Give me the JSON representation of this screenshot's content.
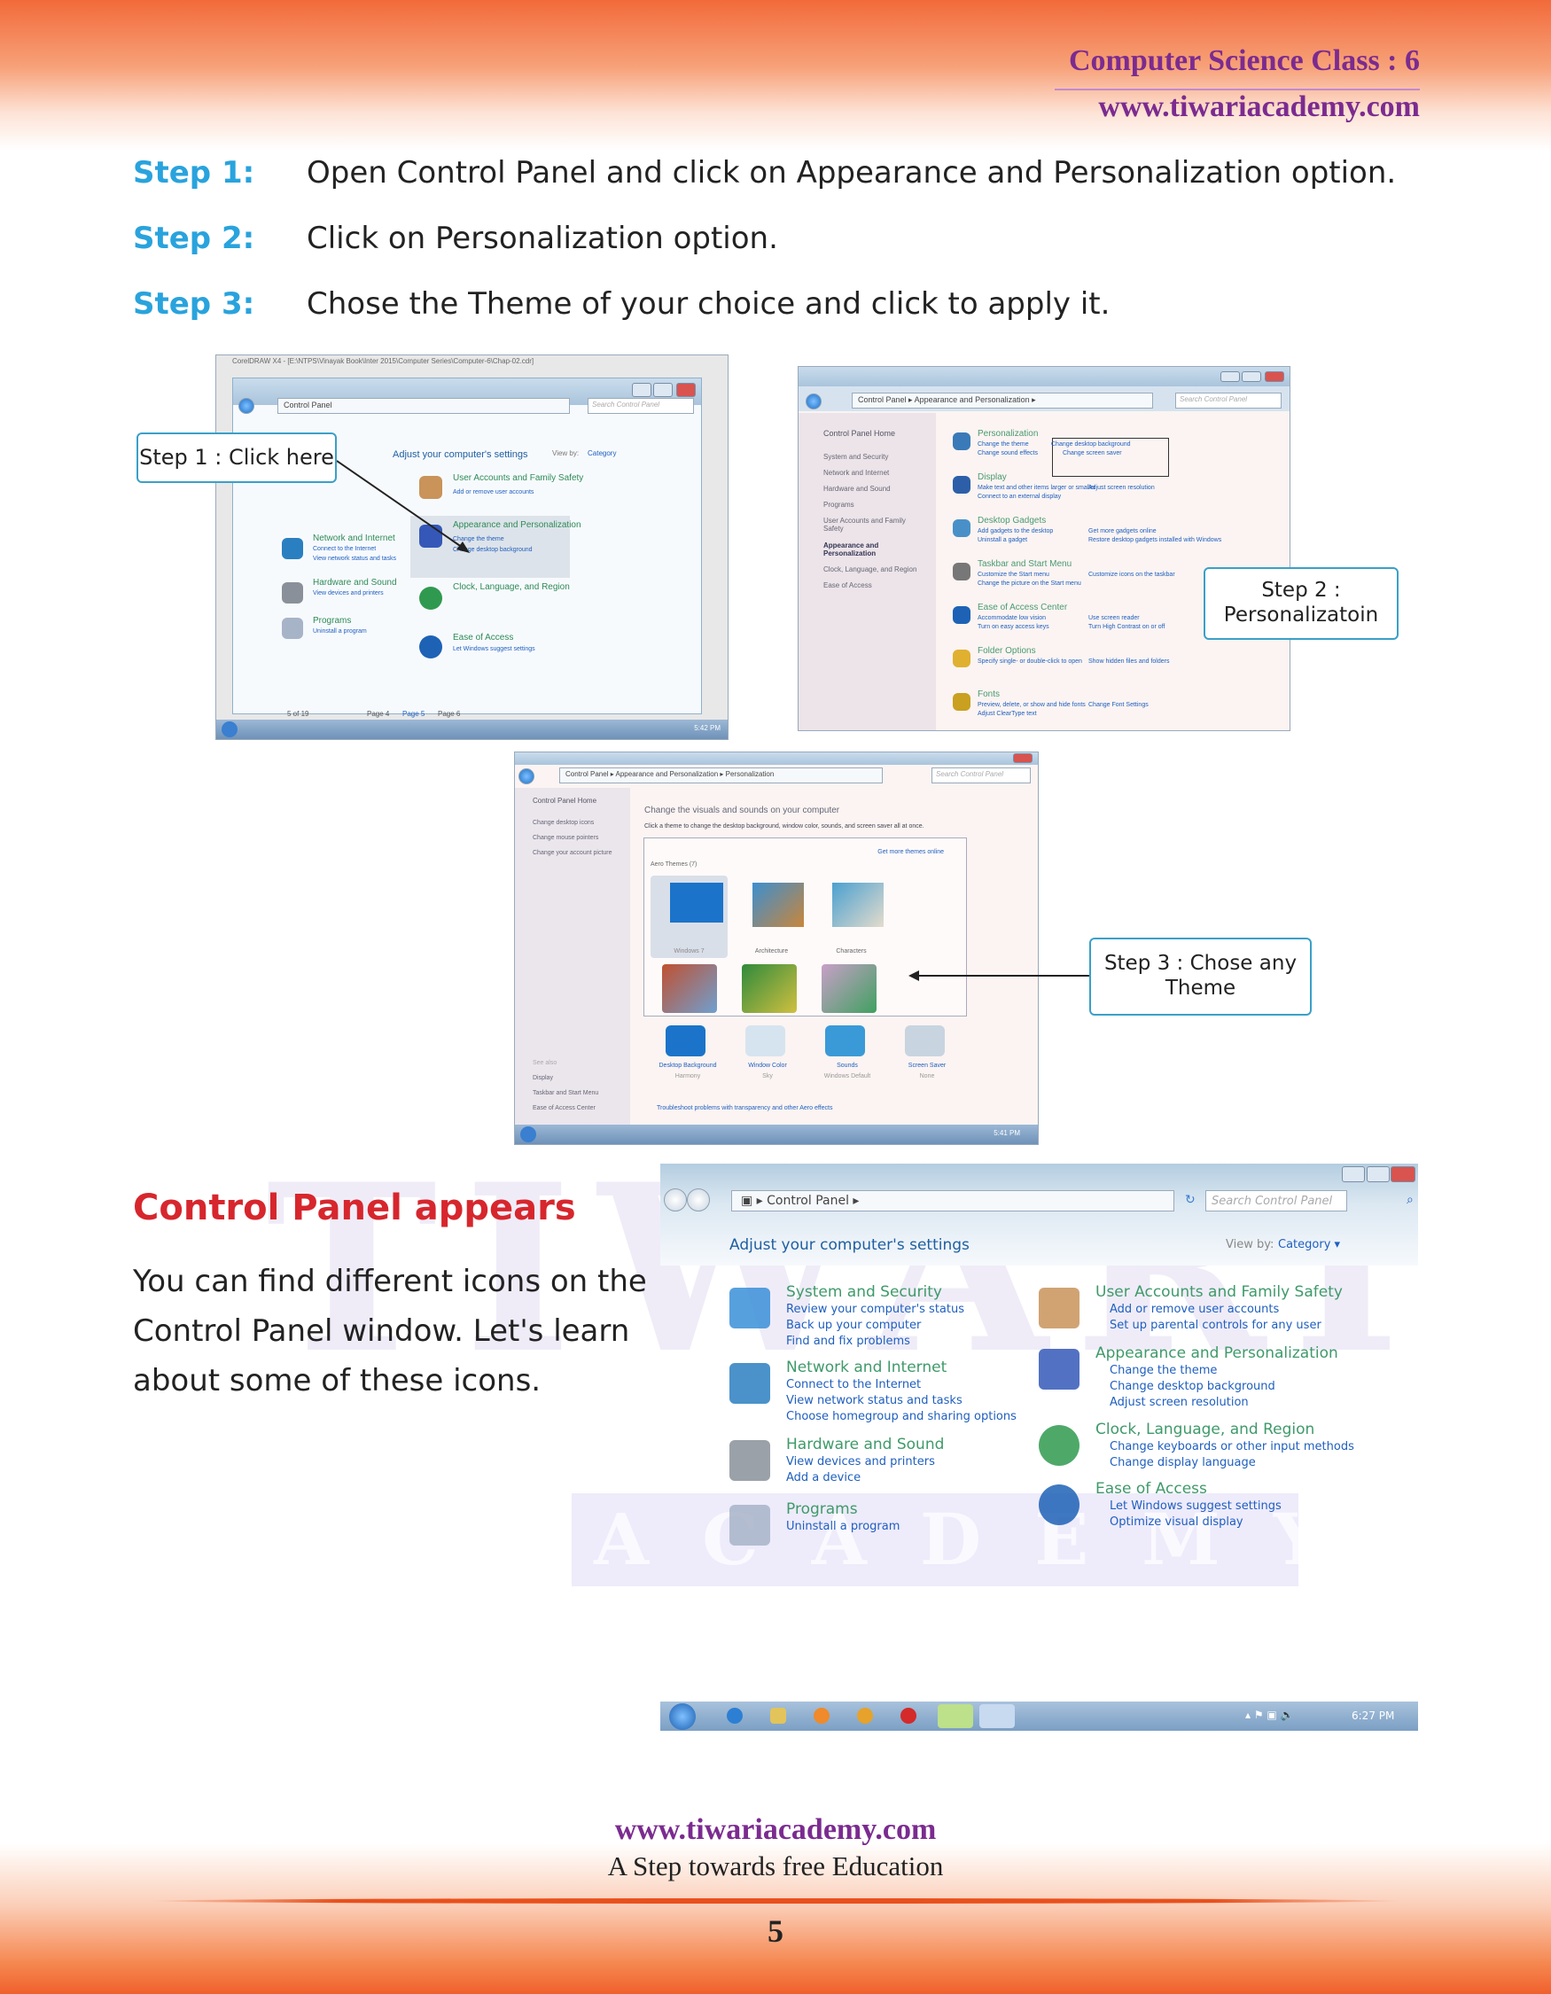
{
  "header": {
    "class_label": "Computer Science Class : 6",
    "website": "www.tiwariacademy.com"
  },
  "steps": [
    {
      "label": "Step 1:",
      "text": "Open Control Panel and click on Appearance and Personalization option."
    },
    {
      "label": "Step 2:",
      "text": "Click on Personalization option."
    },
    {
      "label": "Step 3:",
      "text": "Chose the Theme of your choice and click to apply it."
    }
  ],
  "callouts": {
    "step1": "Step 1 : Click here",
    "step2": "Step 2 : Personalizatoin",
    "step3": "Step 3 : Chose any Theme"
  },
  "shot1": {
    "app_title": "CorelDRAW X4 - [E:\\NTPS\\Vinayak Book\\Inter 2015\\Computer Series\\Computer-6\\Chap-02.cdr]",
    "breadcrumb": "Control Panel",
    "search_placeholder": "Search Control Panel",
    "heading": "Adjust your computer's settings",
    "view_by": "View by:",
    "view_value": "Category",
    "page_nav": "5 of 19",
    "page_tabs": [
      "Page 4",
      "Page 5",
      "Page 6"
    ],
    "time": "5:42 PM"
  },
  "shot2": {
    "breadcrumb": [
      "Control Panel",
      "Appearance and Personalization"
    ],
    "search_placeholder": "Search Control Panel",
    "sidebar": [
      "Control Panel Home",
      "System and Security",
      "Network and Internet",
      "Hardware and Sound",
      "Programs",
      "User Accounts and Family Safety",
      "Appearance and Personalization",
      "Clock, Language, and Region",
      "Ease of Access"
    ],
    "sections": [
      {
        "title": "Personalization",
        "links": [
          "Change the theme",
          "Change desktop background",
          "Change sound effects",
          "Change screen saver"
        ]
      },
      {
        "title": "Display",
        "links": [
          "Make text and other items larger or smaller",
          "Adjust screen resolution",
          "Connect to an external display"
        ]
      },
      {
        "title": "Desktop Gadgets",
        "links": [
          "Add gadgets to the desktop",
          "Get more gadgets online",
          "Uninstall a gadget",
          "Restore desktop gadgets installed with Windows"
        ]
      },
      {
        "title": "Taskbar and Start Menu",
        "links": [
          "Customize the Start menu",
          "Customize icons on the taskbar",
          "Change the picture on the Start menu"
        ]
      },
      {
        "title": "Ease of Access Center",
        "links": [
          "Accommodate low vision",
          "Use screen reader",
          "Turn on easy access keys",
          "Turn High Contrast on or off"
        ]
      },
      {
        "title": "Folder Options",
        "links": [
          "Specify single- or double-click to open",
          "Show hidden files and folders"
        ]
      },
      {
        "title": "Fonts",
        "links": [
          "Preview, delete, or show and hide fonts",
          "Change Font Settings",
          "Adjust ClearType text"
        ]
      }
    ]
  },
  "shot3": {
    "breadcrumb": [
      "Control Panel",
      "Appearance and Personalization",
      "Personalization"
    ],
    "search_placeholder": "Search Control Panel",
    "sidebar": [
      "Control Panel Home",
      "Change desktop icons",
      "Change mouse pointers",
      "Change your account picture"
    ],
    "see_also": "See also",
    "see_also_links": [
      "Display",
      "Taskbar and Start Menu",
      "Ease of Access Center"
    ],
    "heading": "Change the visuals and sounds on your computer",
    "subheading": "Click a theme to change the desktop background, window color, sounds, and screen saver all at once.",
    "more_themes": "Get more themes online",
    "group": "Aero Themes (7)",
    "themes": [
      "Windows 7",
      "Architecture",
      "Characters"
    ],
    "settings": [
      {
        "label": "Desktop Background",
        "value": "Harmony"
      },
      {
        "label": "Window Color",
        "value": "Sky"
      },
      {
        "label": "Sounds",
        "value": "Windows Default"
      },
      {
        "label": "Screen Saver",
        "value": "None"
      }
    ],
    "troubleshoot": "Troubleshoot problems with transparency and other Aero effects",
    "time": "5:41 PM"
  },
  "section": {
    "title": "Control Panel appears",
    "body": "You can find different icons on the Control Panel window. Let's learn about some of these icons."
  },
  "cp": {
    "breadcrumb": "Control Panel",
    "search_placeholder": "Search Control Panel",
    "heading": "Adjust your computer's settings",
    "view_by": "View by:",
    "view_value": "Category",
    "left": [
      {
        "title": "System and Security",
        "links": [
          "Review your computer's status",
          "Back up your computer",
          "Find and fix problems"
        ],
        "icon": "shield-icon",
        "color": "#3a8fd8"
      },
      {
        "title": "Network and Internet",
        "links": [
          "Connect to the Internet",
          "View network status and tasks",
          "Choose homegroup and sharing options"
        ],
        "icon": "globe-network-icon",
        "color": "#2a7fc0"
      },
      {
        "title": "Hardware and Sound",
        "links": [
          "View devices and printers",
          "Add a device"
        ],
        "icon": "printer-icon",
        "color": "#8a9099"
      },
      {
        "title": "Programs",
        "links": [
          "Uninstall a program"
        ],
        "icon": "programs-icon",
        "color": "#a7b4c8"
      }
    ],
    "right": [
      {
        "title": "User Accounts and Family Safety",
        "links": [
          "Add or remove user accounts",
          "Set up parental controls for any user"
        ],
        "icon": "users-icon",
        "color": "#c9935a"
      },
      {
        "title": "Appearance and Personalization",
        "links": [
          "Change the theme",
          "Change desktop background",
          "Adjust screen resolution"
        ],
        "icon": "monitor-icon",
        "color": "#3558b8"
      },
      {
        "title": "Clock, Language, and Region",
        "links": [
          "Change keyboards or other input methods",
          "Change display language"
        ],
        "icon": "clock-globe-icon",
        "color": "#2f9a4f"
      },
      {
        "title": "Ease of Access",
        "links": [
          "Let Windows suggest settings",
          "Optimize visual display"
        ],
        "icon": "ease-of-access-icon",
        "color": "#1d62b5"
      }
    ],
    "time": "6:27 PM"
  },
  "watermark": {
    "line1": "TIWARI",
    "line2": "ACADEMY"
  },
  "footer": {
    "website": "www.tiwariacademy.com",
    "tagline": "A Step towards free Education",
    "page_number": "5"
  },
  "colors": {
    "step_label": "#29a3dd",
    "heading_red": "#d7262d",
    "brand_purple": "#7b2b90",
    "band_orange": "#f26a3a"
  }
}
